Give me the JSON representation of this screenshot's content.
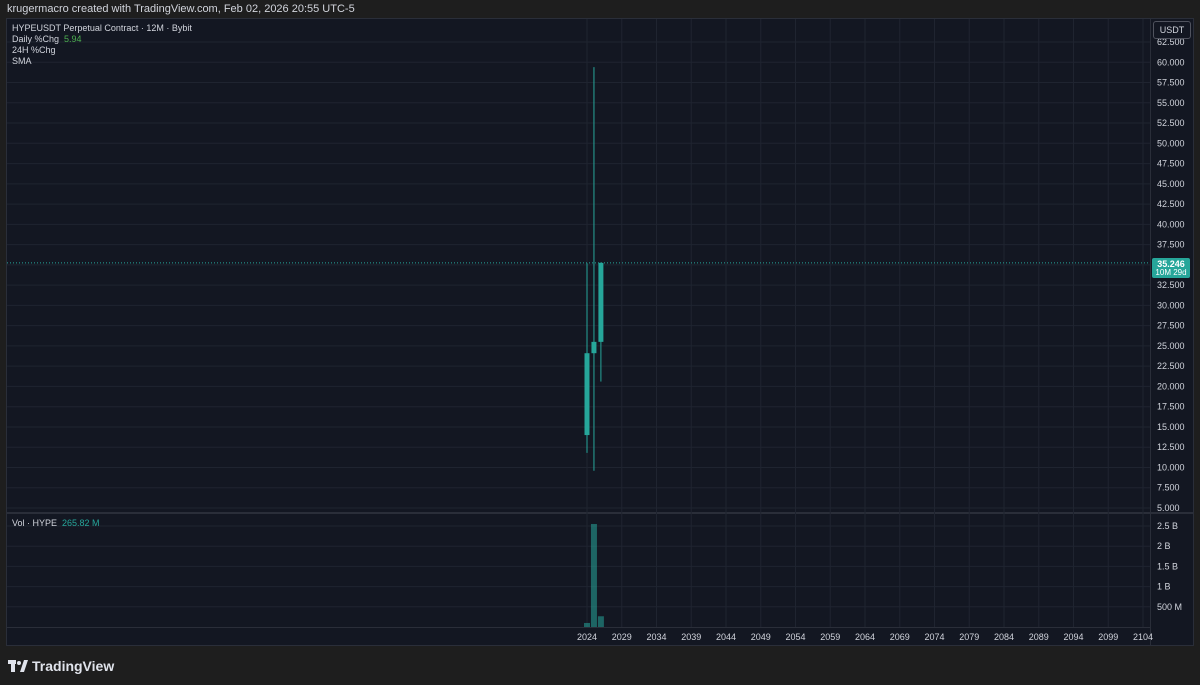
{
  "header": {
    "attribution": "krugermacro created with TradingView.com, Feb 02, 2026 20:55 UTC-5"
  },
  "legend": {
    "symbol_line": "HYPEUSDT Perpetual Contract · 12M · Bybit",
    "daily_chg_label": "Daily %Chg",
    "daily_chg_value": "5.94",
    "h24_chg_label": "24H %Chg",
    "sma_label": "SMA",
    "volume_label": "Vol · HYPE",
    "volume_value": "265.82 M"
  },
  "currency_button": "USDT",
  "last_price": {
    "price": "35.246",
    "countdown": "10M 29d"
  },
  "footer": {
    "brand": "TradingView"
  },
  "colors": {
    "up": "#26a69a",
    "background": "#131722",
    "grid": "#2a2e39",
    "text": "#d1d4dc"
  },
  "chart_data": [
    {
      "type": "candlestick",
      "title": "HYPEUSDT Perpetual Contract · 12M · Bybit",
      "ylim": [
        5.0,
        62.5
      ],
      "y_ticks": [
        "62.500",
        "60.000",
        "57.500",
        "55.000",
        "52.500",
        "50.000",
        "47.500",
        "45.000",
        "42.500",
        "40.000",
        "37.500",
        "35.000",
        "32.500",
        "30.000",
        "27.500",
        "25.000",
        "22.500",
        "20.000",
        "17.500",
        "15.000",
        "12.500",
        "10.000",
        "7.500",
        "5.000"
      ],
      "x_ticks": [
        "2024",
        "2029",
        "2034",
        "2039",
        "2044",
        "2049",
        "2054",
        "2059",
        "2064",
        "2069",
        "2074",
        "2079",
        "2084",
        "2089",
        "2094",
        "2099",
        "2104"
      ],
      "candles": [
        {
          "x": 2024,
          "open": 14.0,
          "high": 35.2,
          "low": 11.8,
          "close": 24.1
        },
        {
          "x": 2025,
          "open": 24.1,
          "high": 59.4,
          "low": 9.6,
          "close": 25.5
        },
        {
          "x": 2026,
          "open": 25.5,
          "high": 35.3,
          "low": 20.6,
          "close": 35.246
        }
      ],
      "last_price": 35.246
    },
    {
      "type": "bar",
      "title": "Vol · HYPE",
      "ylim": [
        0,
        2.6
      ],
      "y_unit": "B",
      "y_ticks": [
        "2.5 B",
        "2 B",
        "1.5 B",
        "1 B",
        "500 M"
      ],
      "values": [
        {
          "x": 2024,
          "value": 0.1
        },
        {
          "x": 2025,
          "value": 2.55
        },
        {
          "x": 2026,
          "value": 0.26582
        }
      ]
    }
  ]
}
